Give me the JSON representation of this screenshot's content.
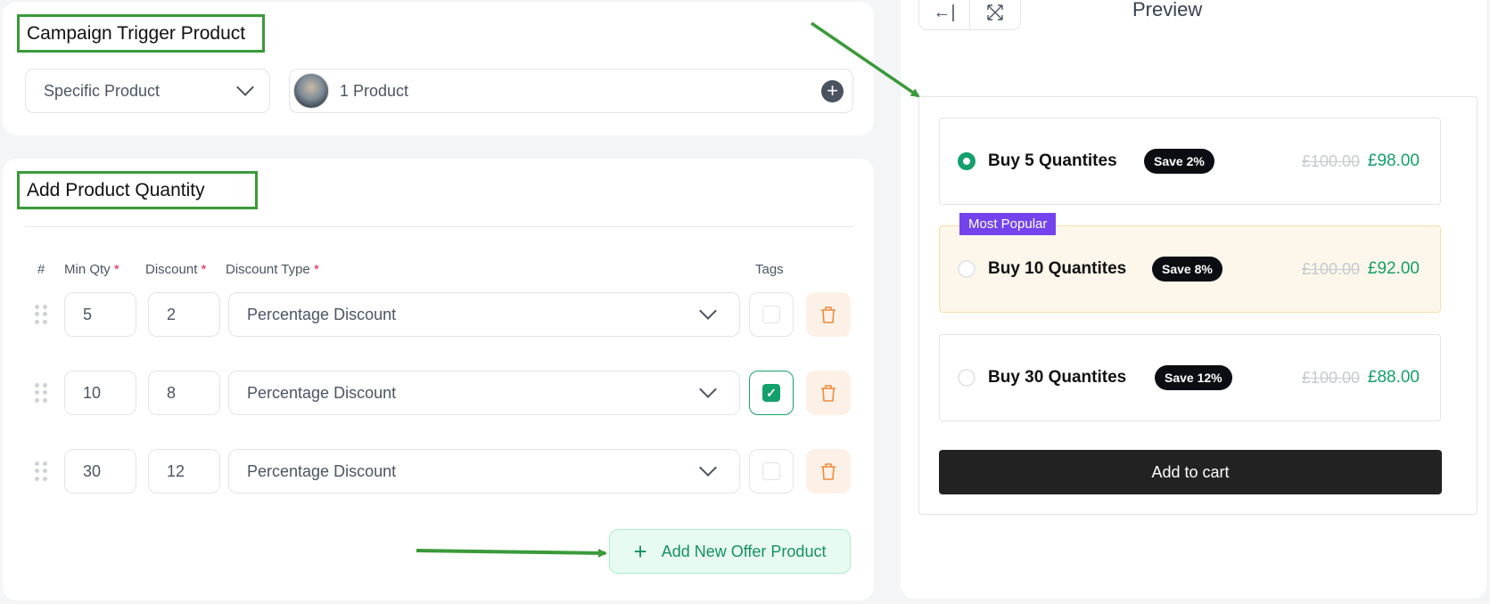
{
  "trigger": {
    "title": "Campaign Trigger Product",
    "product_type_select": "Specific Product",
    "product_picker_label": "1 Product"
  },
  "quantity": {
    "title": "Add Product Quantity",
    "columns": {
      "index": "#",
      "min_qty": "Min Qty",
      "discount": "Discount",
      "discount_type": "Discount Type",
      "tags": "Tags",
      "required_mark": "*"
    },
    "rows": [
      {
        "min_qty": "5",
        "discount": "2",
        "discount_type": "Percentage Discount",
        "tag_checked": false
      },
      {
        "min_qty": "10",
        "discount": "8",
        "discount_type": "Percentage Discount",
        "tag_checked": true
      },
      {
        "min_qty": "30",
        "discount": "12",
        "discount_type": "Percentage Discount",
        "tag_checked": false
      }
    ],
    "add_button_label": "Add New Offer Product"
  },
  "preview": {
    "title": "Preview",
    "popular_tag": "Most Popular",
    "offers": [
      {
        "label": "Buy 5 Quantites",
        "badge": "Save 2%",
        "old_price": "£100.00",
        "new_price": "£98.00",
        "selected": true
      },
      {
        "label": "Buy 10 Quantites",
        "badge": "Save 8%",
        "old_price": "£100.00",
        "new_price": "£92.00",
        "selected": false
      },
      {
        "label": "Buy 30 Quantites",
        "badge": "Save 12%",
        "old_price": "£100.00",
        "new_price": "£88.00",
        "selected": false
      }
    ],
    "add_to_cart_label": "Add to cart"
  },
  "colors": {
    "accent_green": "#13a06b",
    "annotation_green": "#3a9a3a",
    "popular_purple": "#7443ee",
    "delete_orange": "#f08a3c"
  }
}
